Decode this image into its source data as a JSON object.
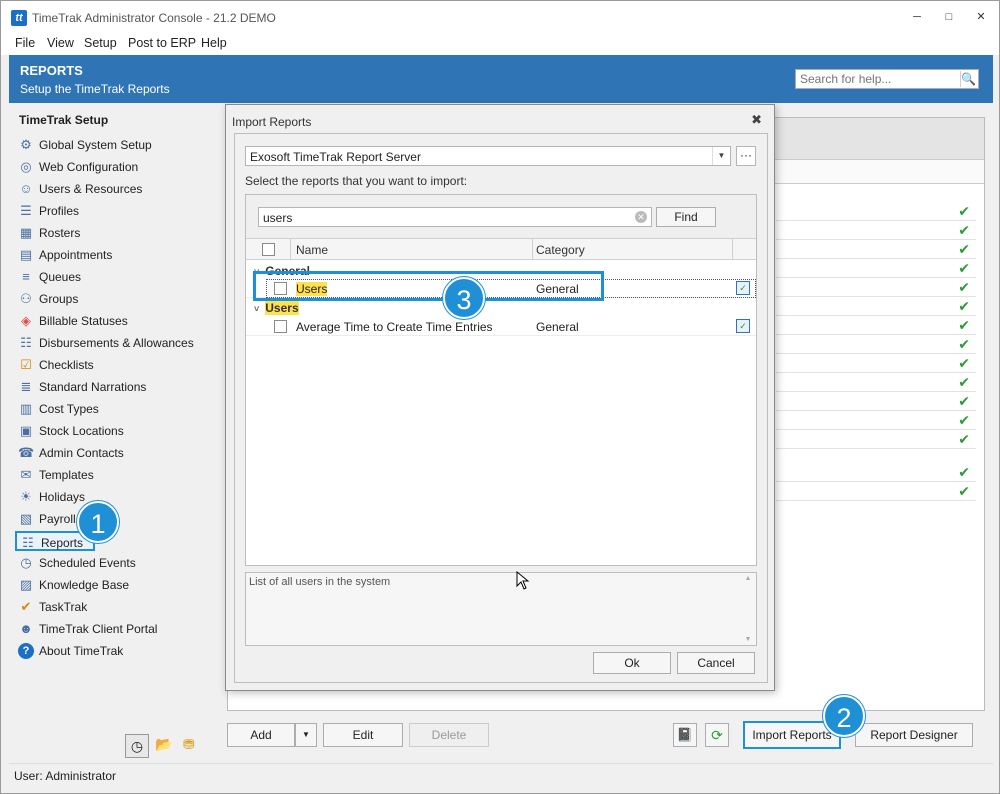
{
  "window": {
    "title": "TimeTrak Administrator Console - 21.2 DEMO",
    "logo": "tt",
    "min": "─",
    "restore": "□",
    "close": "✕"
  },
  "menu": [
    "File",
    "View",
    "Setup",
    "Post to ERP",
    "Help"
  ],
  "banner": {
    "title": "REPORTS",
    "subtitle": "Setup the TimeTrak Reports",
    "search_placeholder": "Search for help..."
  },
  "sidebar": {
    "heading": "TimeTrak Setup",
    "items": [
      {
        "label": "Global System Setup",
        "icon": "gear-icon"
      },
      {
        "label": "Web Configuration",
        "icon": "globe-icon"
      },
      {
        "label": "Users & Resources",
        "icon": "users-icon"
      },
      {
        "label": "Profiles",
        "icon": "profile-icon"
      },
      {
        "label": "Rosters",
        "icon": "roster-icon"
      },
      {
        "label": "Appointments",
        "icon": "calendar-icon"
      },
      {
        "label": "Queues",
        "icon": "queue-icon"
      },
      {
        "label": "Groups",
        "icon": "group-icon"
      },
      {
        "label": "Billable Statuses",
        "icon": "tag-icon"
      },
      {
        "label": "Disbursements & Allowances",
        "icon": "receipt-icon"
      },
      {
        "label": "Checklists",
        "icon": "checklist-icon"
      },
      {
        "label": "Standard Narrations",
        "icon": "narration-icon"
      },
      {
        "label": "Cost Types",
        "icon": "cost-icon"
      },
      {
        "label": "Stock Locations",
        "icon": "stock-icon"
      },
      {
        "label": "Admin Contacts",
        "icon": "contacts-icon"
      },
      {
        "label": "Templates",
        "icon": "mail-icon"
      },
      {
        "label": "Holidays",
        "icon": "holiday-icon"
      },
      {
        "label": "Payroll",
        "icon": "payroll-icon"
      },
      {
        "label": "Reports",
        "icon": "reports-icon"
      },
      {
        "label": "Scheduled Events",
        "icon": "clock-icon"
      },
      {
        "label": "Knowledge Base",
        "icon": "book-icon"
      },
      {
        "label": "TaskTrak",
        "icon": "task-icon"
      },
      {
        "label": "TimeTrak Client Portal",
        "icon": "portal-icon"
      },
      {
        "label": "About TimeTrak",
        "icon": "help-icon"
      }
    ]
  },
  "toolbar": {
    "add": "Add",
    "edit": "Edit",
    "delete": "Delete",
    "import": "Import Reports",
    "designer": "Report Designer"
  },
  "status": "User: Administrator",
  "dialog": {
    "title": "Import Reports",
    "server": "Exosoft TimeTrak Report Server",
    "prompt": "Select the reports that you want to import:",
    "filter": "users",
    "find": "Find",
    "col_name": "Name",
    "col_category": "Category",
    "groups": [
      {
        "label": "General",
        "rows": [
          {
            "name": "Users",
            "category": "General"
          }
        ]
      },
      {
        "label": "Users",
        "rows": [
          {
            "name": "Average Time to Create Time Entries",
            "category": "General"
          }
        ]
      }
    ],
    "description": "List of all users in the system",
    "ok": "Ok",
    "cancel": "Cancel"
  },
  "callouts": [
    "1",
    "2",
    "3"
  ],
  "accent": "#2f75b5",
  "highlight": "#1e90d8"
}
